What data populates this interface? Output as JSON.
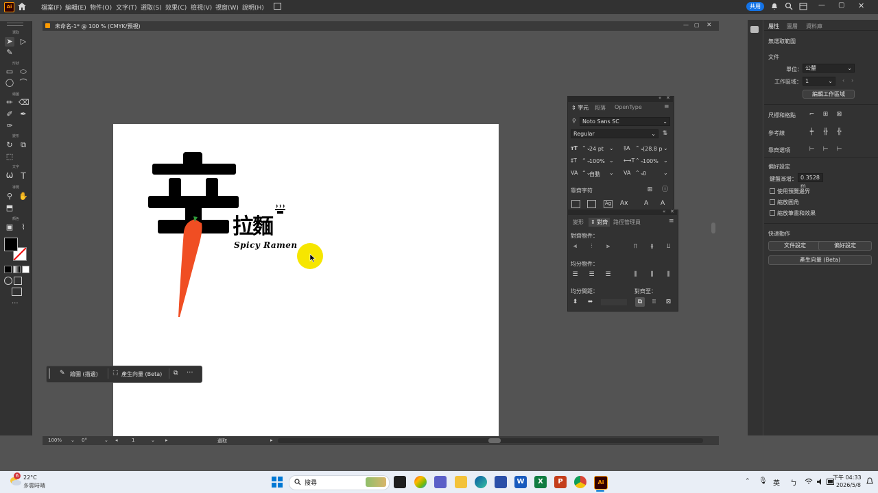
{
  "app": {
    "logo": "Ai",
    "share": "共用"
  },
  "menu": [
    "檔案(F)",
    "編輯(E)",
    "物件(O)",
    "文字(T)",
    "選取(S)",
    "效果(C)",
    "檢視(V)",
    "視窗(W)",
    "說明(H)"
  ],
  "toolbar": {
    "sections": [
      "選取",
      "形狀",
      "繪圖",
      "變形",
      "文字",
      "導覽",
      "顏色"
    ],
    "more": "···"
  },
  "document": {
    "tab_title": "未命名-1* @ 100 % (CMYK/預視)",
    "status": {
      "zoom": "100%",
      "rotate": "0°",
      "artboard": "1",
      "tool": "選取"
    }
  },
  "artwork": {
    "big_char": "辛",
    "word": "拉麵",
    "subtitle": "Spicy Ramen"
  },
  "char_panel": {
    "tabs": [
      "字元",
      "段落",
      "OpenType"
    ],
    "font_family": "Noto Sans SC",
    "font_style": "Regular",
    "font_size": "24 pt",
    "leading": "(28.8 p",
    "vscale": "100%",
    "hscale": "100%",
    "kerning": "自動",
    "tracking": "0",
    "snap_label": "靠齊字符"
  },
  "align_panel": {
    "tabs": [
      "變形",
      "對齊",
      "路徑管理員"
    ],
    "align_objects": "對齊物件：",
    "distribute_objects": "均分物件：",
    "distribute_spacing": "均分間距：",
    "align_to": "對齊至："
  },
  "properties": {
    "tabs": [
      "屬性",
      "圖層",
      "資料庫"
    ],
    "no_selection": "無選取範圍",
    "document_head": "文件",
    "units_label": "單位：",
    "units_value": "公釐",
    "artboard_label": "工作區域：",
    "artboard_value": "1",
    "edit_artboards": "編輯工作區域",
    "rulers_grids": "尺標和格點",
    "guides": "參考線",
    "snap_options": "靠齊選項",
    "preferences_head": "偏好設定",
    "keyboard_increment_label": "鍵盤漸增：",
    "keyboard_increment_value": "0.3528 m",
    "chk_preview_bounds": "使用預覽邊界",
    "chk_scale_corners": "縮放圓角",
    "chk_scale_strokes": "縮放筆畫和效果",
    "quick_actions": "快速動作",
    "doc_setup": "文件設定",
    "prefs_btn": "偏好設定",
    "generate_vectors": "產生向量 (Beta)"
  },
  "ctxbar": {
    "recolor": "繪圖 (描邊)",
    "generate": "產生向量 (Beta)",
    "more": "···"
  },
  "taskbar": {
    "weather_temp": "22°C",
    "weather_desc": "多雲時晴",
    "weather_badge": "6",
    "search": "搜尋",
    "lang": "英",
    "time": "下午 04:33",
    "date": "2026/5/8"
  },
  "colors": {
    "accent": "#1473e6",
    "carrot": "#f04e23",
    "stem": "#2e9c3c",
    "cursor": "#f6e600"
  }
}
